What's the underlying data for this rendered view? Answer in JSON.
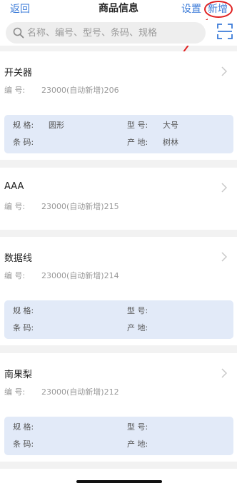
{
  "nav": {
    "back": "返回",
    "title": "商品信息",
    "settings": "设置",
    "add": "新增"
  },
  "search": {
    "placeholder": "名称、编号、型号、条码、规格"
  },
  "labels": {
    "code": "编 号:",
    "spec": "规 格:",
    "model": "型 号:",
    "barcode": "条 码:",
    "origin": "产 地:"
  },
  "products": [
    {
      "name": "开关器",
      "code": "23000(自动新增)206",
      "spec": "圆形",
      "model": "大号",
      "barcode": "",
      "origin": "树林"
    },
    {
      "name": "AAA",
      "code": "23000(自动新增)215"
    },
    {
      "name": "数据线",
      "code": "23000(自动新增)214",
      "spec": "",
      "model": "",
      "barcode": "",
      "origin": ""
    },
    {
      "name": "南果梨",
      "code": "23000(自动新增)212",
      "spec": "",
      "model": "",
      "barcode": "",
      "origin": ""
    }
  ],
  "colors": {
    "accent": "#3b7bd8",
    "annotation": "#e02020",
    "spec_bg": "#e2eaf8"
  },
  "icons": [
    "search-icon",
    "scan-icon",
    "chevron-right-icon"
  ]
}
